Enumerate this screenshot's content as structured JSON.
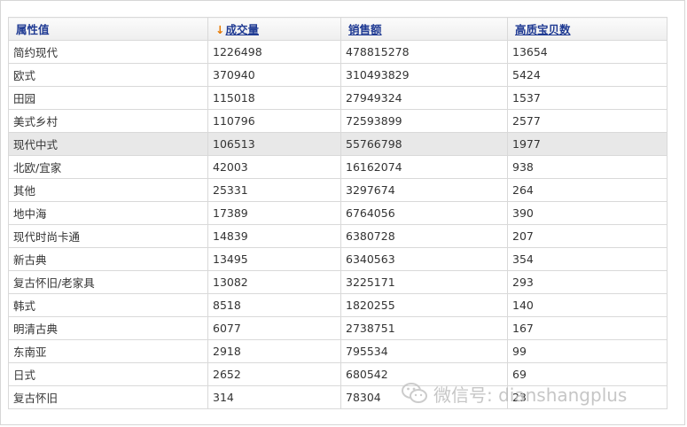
{
  "table": {
    "headers": {
      "attribute": "属性值",
      "sort_indicator": "↓",
      "volume": "成交量",
      "sales": "销售额",
      "quality_items": "高质宝贝数"
    },
    "rows": [
      {
        "attribute": "简约现代",
        "volume": "1226498",
        "sales": "478815278",
        "quality_items": "13654"
      },
      {
        "attribute": "欧式",
        "volume": "370940",
        "sales": "310493829",
        "quality_items": "5424"
      },
      {
        "attribute": "田园",
        "volume": "115018",
        "sales": "27949324",
        "quality_items": "1537"
      },
      {
        "attribute": "美式乡村",
        "volume": "110796",
        "sales": "72593899",
        "quality_items": "2577"
      },
      {
        "attribute": "现代中式",
        "volume": "106513",
        "sales": "55766798",
        "quality_items": "1977"
      },
      {
        "attribute": "北欧/宜家",
        "volume": "42003",
        "sales": "16162074",
        "quality_items": "938"
      },
      {
        "attribute": "其他",
        "volume": "25331",
        "sales": "3297674",
        "quality_items": "264"
      },
      {
        "attribute": "地中海",
        "volume": "17389",
        "sales": "6764056",
        "quality_items": "390"
      },
      {
        "attribute": "现代时尚卡通",
        "volume": "14839",
        "sales": "6380728",
        "quality_items": "207"
      },
      {
        "attribute": "新古典",
        "volume": "13495",
        "sales": "6340563",
        "quality_items": "354"
      },
      {
        "attribute": "复古怀旧/老家具",
        "volume": "13082",
        "sales": "3225171",
        "quality_items": "293"
      },
      {
        "attribute": "韩式",
        "volume": "8518",
        "sales": "1820255",
        "quality_items": "140"
      },
      {
        "attribute": "明清古典",
        "volume": "6077",
        "sales": "2738751",
        "quality_items": "167"
      },
      {
        "attribute": "东南亚",
        "volume": "2918",
        "sales": "795534",
        "quality_items": "99"
      },
      {
        "attribute": "日式",
        "volume": "2652",
        "sales": "680542",
        "quality_items": "69"
      },
      {
        "attribute": "复古怀旧",
        "volume": "314",
        "sales": "78304",
        "quality_items": "23"
      }
    ],
    "highlighted_row": 4
  },
  "watermark": {
    "icon": "wechat-icon",
    "text": "微信号: dianshangplus"
  },
  "colors": {
    "header_text": "#1f3a93",
    "sort_arrow": "#e87a00",
    "highlight_row": "#e8e8e8",
    "border": "#d9d9d9"
  }
}
